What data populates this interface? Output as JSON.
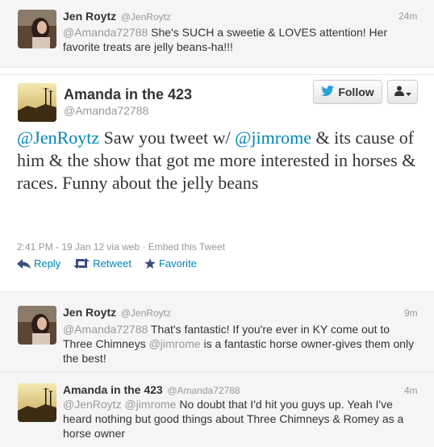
{
  "colors": {
    "link": "#0084b4",
    "muted": "#999999",
    "text": "#333333",
    "reply_bg": "#f5f5f5"
  },
  "tweets": {
    "top": {
      "fullname": "Jen Roytz",
      "username": "@JenRoytz",
      "time": "24m",
      "mention": "@Amanda72788",
      "text": " She's SUCH a sweetie & LOVES attention! Her favorite treats are jelly beans-ha!!!"
    },
    "main": {
      "fullname": "Amanda in the 423",
      "username": "@Amanda72788",
      "follow_label": "Follow",
      "follow_icon": "twitter-bird-icon",
      "user_menu_icon": "user-icon",
      "text_parts": {
        "m1": "@JenRoytz",
        "t1": " Saw you tweet w/ ",
        "m2": "@jimrome",
        "t2": " & its cause of him & the show that got me more interested in horses & races. Funny about the jelly beans"
      },
      "meta": "2:41 PM - 19 Jan 12 via web · Embed this Tweet",
      "actions": {
        "reply": "Reply",
        "retweet": "Retweet",
        "favorite": "Favorite"
      }
    },
    "reply1": {
      "fullname": "Jen Roytz",
      "username": "@JenRoytz",
      "time": "9m",
      "m1": "@Amanda72788",
      "t1": " That's fantastic! If you're ever in KY come out to Three Chimneys ",
      "m2": "@jimrome",
      "t2": " is a fantastic horse owner-gives them only the best!"
    },
    "reply2": {
      "fullname": "Amanda in the 423",
      "username": "@Amanda72788",
      "time": "4m",
      "m1": "@JenRoytz",
      "m2": "@jimrome",
      "t2": " No doubt that I'd hit you guys up. Yeah I've heard nothing but good things about Three Chimneys & Romey as a horse owner"
    }
  }
}
